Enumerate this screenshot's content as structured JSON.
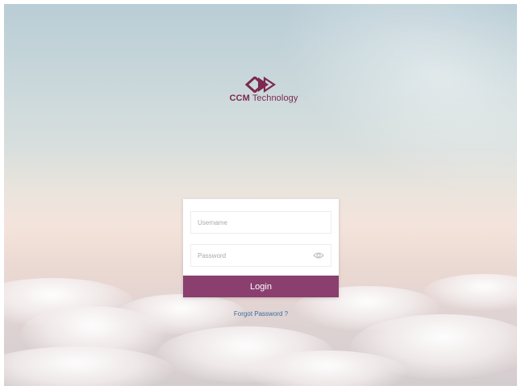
{
  "brand": {
    "name_bold": "CCM",
    "name_rest": "Technology",
    "color": "#7b2a4f"
  },
  "login_form": {
    "username_placeholder": "Username",
    "password_placeholder": "Password",
    "username_value": "",
    "password_value": "",
    "show_password_icon": "eye-icon",
    "login_label": "Login",
    "login_color": "#8a3f6f"
  },
  "links": {
    "forgot_password": "Forgot Password ?"
  }
}
